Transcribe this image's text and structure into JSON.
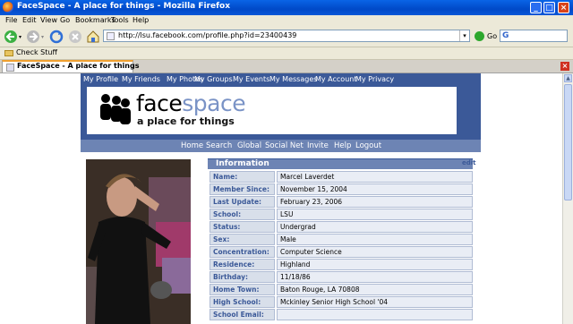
{
  "window": {
    "title": "FaceSpace - A place for things - Mozilla Firefox",
    "controls": [
      "minimize",
      "maximize",
      "close"
    ]
  },
  "menubar": [
    "File",
    "Edit",
    "View",
    "Go",
    "Bookmarks",
    "Tools",
    "Help"
  ],
  "toolbar": {
    "url": "http://lsu.facebook.com/profile.php?id=23400439",
    "go_label": "Go",
    "search_engine": "G"
  },
  "bookmarks": {
    "item": "Check Stuff"
  },
  "tabs": [
    {
      "label": "FaceSpace - A place for things"
    }
  ],
  "site": {
    "nav": [
      "My Profile",
      "My Friends",
      "My Photos",
      "My Groups",
      "My Events",
      "My Messages",
      "My Account",
      "My Privacy"
    ],
    "brand_face": "face",
    "brand_space": "space",
    "tagline": "a place for things",
    "subnav": [
      "Home",
      "Search",
      "Global",
      "Social Net",
      "Invite",
      "Help",
      "Logout"
    ]
  },
  "profile": {
    "section_title": "Information",
    "edit_label": "edit",
    "fields": [
      {
        "label": "Name:",
        "value": "Marcel Laverdet"
      },
      {
        "label": "Member Since:",
        "value": "November 15, 2004"
      },
      {
        "label": "Last Update:",
        "value": "February 23, 2006"
      },
      {
        "label": "School:",
        "value": "LSU"
      },
      {
        "label": "Status:",
        "value": "Undergrad"
      },
      {
        "label": "Sex:",
        "value": "Male"
      },
      {
        "label": "Concentration:",
        "value": "Computer Science"
      },
      {
        "label": "Residence:",
        "value": "Highland"
      },
      {
        "label": "Birthday:",
        "value": "11/18/86"
      },
      {
        "label": "Home Town:",
        "value": "Baton Rouge, LA 70808"
      },
      {
        "label": "High School:",
        "value": "Mckinley Senior High School '04"
      },
      {
        "label": "School Email:",
        "value": ""
      }
    ]
  },
  "colors": {
    "nav_bg": "#3b5998",
    "subnav_bg": "#6d84b4",
    "label_bg": "#d8dfea",
    "value_bg": "#e9edf5"
  }
}
